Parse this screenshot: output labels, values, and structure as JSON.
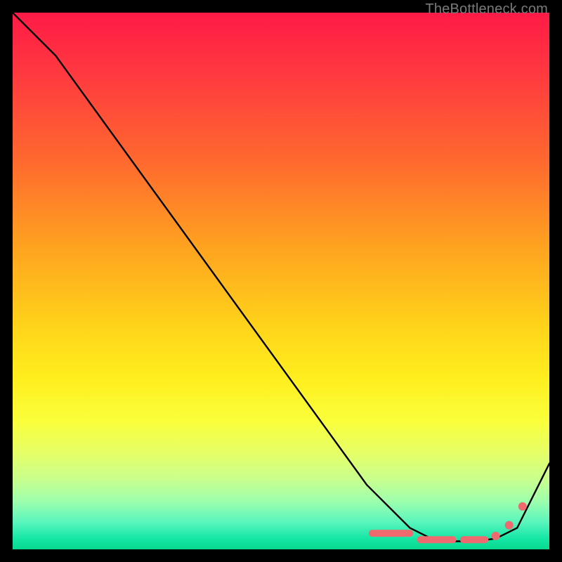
{
  "watermark": "TheBottleneck.com",
  "chart_data": {
    "type": "line",
    "title": "",
    "xlabel": "",
    "ylabel": "",
    "xlim": [
      0,
      100
    ],
    "ylim": [
      0,
      100
    ],
    "grid": false,
    "legend": false,
    "series": [
      {
        "name": "bottleneck-curve",
        "x": [
          0,
          8,
          66,
          74,
          78,
          82,
          86,
          90,
          94,
          100
        ],
        "y": [
          100,
          92,
          12,
          4,
          2,
          1.5,
          1.5,
          2,
          4,
          16
        ]
      }
    ],
    "markers": {
      "name": "highlight-band",
      "segments": [
        {
          "x1": 67,
          "x2": 74,
          "y": 3
        },
        {
          "x1": 76,
          "x2": 82,
          "y": 1.8
        },
        {
          "x1": 84,
          "x2": 88,
          "y": 1.8
        }
      ],
      "dots": [
        {
          "x": 90,
          "y": 2.5
        },
        {
          "x": 92.5,
          "y": 4.5
        },
        {
          "x": 95,
          "y": 8
        }
      ]
    },
    "background": {
      "type": "vertical-gradient",
      "stops": [
        {
          "pos": 0.0,
          "color": "#ff1a46"
        },
        {
          "pos": 0.44,
          "color": "#ffa41f"
        },
        {
          "pos": 0.76,
          "color": "#faff3a"
        },
        {
          "pos": 1.0,
          "color": "#08d98f"
        }
      ]
    }
  }
}
